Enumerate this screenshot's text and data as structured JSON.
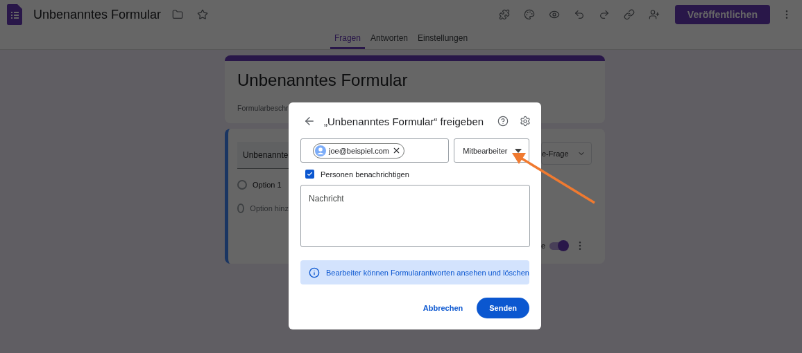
{
  "app": {
    "title": "Unbenanntes Formular",
    "publish_button": "Veröffentlichen"
  },
  "tabs": [
    {
      "label": "Fragen",
      "selected": true
    },
    {
      "label": "Antworten",
      "selected": false
    },
    {
      "label": "Einstellungen",
      "selected": false
    }
  ],
  "form_header": {
    "title": "Unbenanntes Formular",
    "description": "Formularbeschr"
  },
  "question": {
    "title": "Unbenannte",
    "type_select": "e-Frage",
    "options": [
      {
        "kind": "option",
        "label": "Option 1"
      },
      {
        "kind": "add",
        "label": "Option hinz"
      }
    ],
    "required_label": "e",
    "required": true
  },
  "dialog": {
    "title": "„Unbenanntes Formular“ freigeben",
    "recipient": "joe@beispiel.com",
    "role": "Mitbearbeiter",
    "notify": {
      "label": "Personen benachrichtigen",
      "checked": true
    },
    "message_placeholder": "Nachricht",
    "info": "Bearbeiter können Formularantworten ansehen und löschen",
    "cancel_button": "Abbrechen",
    "send_button": "Senden"
  }
}
